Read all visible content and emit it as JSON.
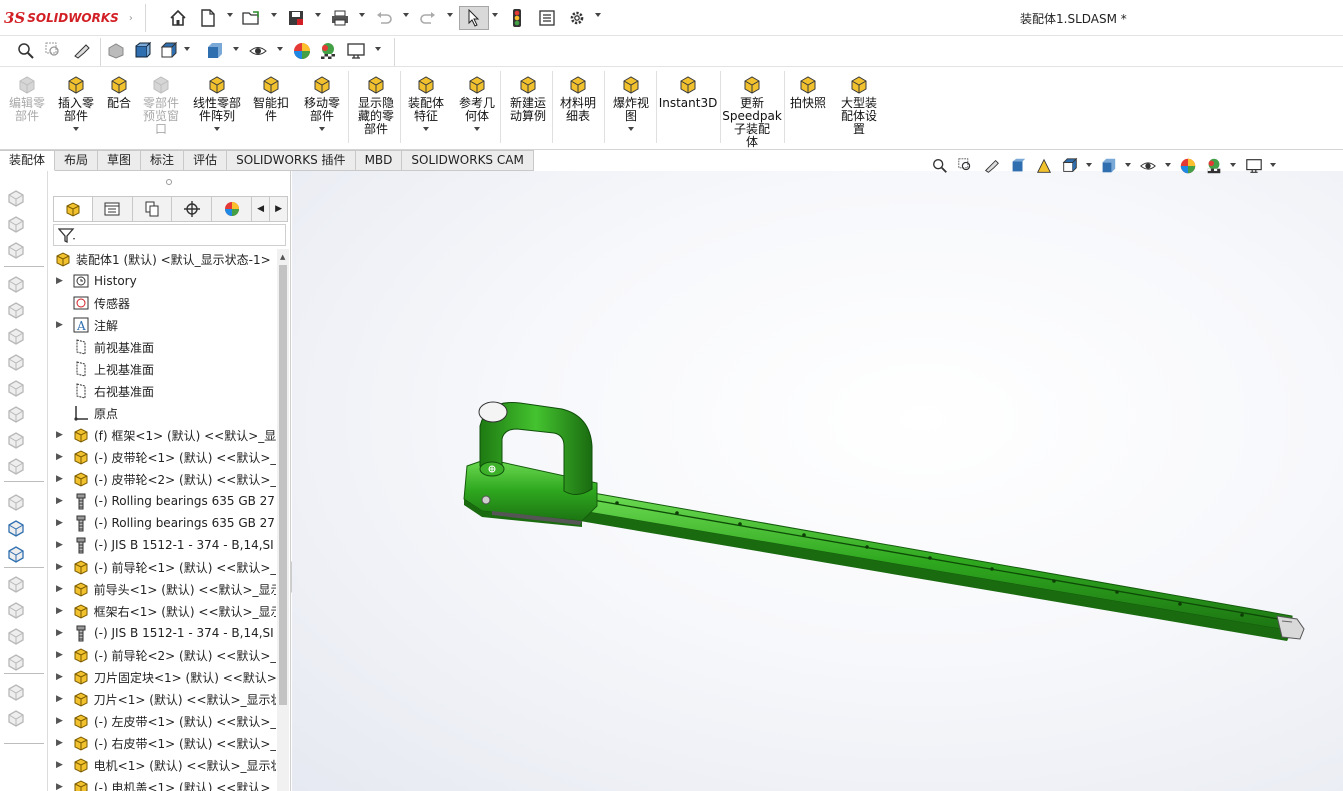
{
  "app": {
    "brand_ds": "3S",
    "brand_name": "SOLIDWORKS",
    "doc_title": "装配体1.SLDASM *"
  },
  "quick_toolbar": {
    "icons": [
      "home-icon",
      "new-document-icon",
      "open-icon",
      "save-icon",
      "print-icon",
      "undo-icon",
      "redo-icon",
      "select-arrow-icon",
      "rebuild-traffic-light-icon",
      "file-properties-icon",
      "options-gear-icon"
    ]
  },
  "ribbon": {
    "items": [
      {
        "label": "编辑零\n部件",
        "disabled": true,
        "dropdown": false
      },
      {
        "label": "插入零\n部件",
        "disabled": false,
        "dropdown": true
      },
      {
        "label": "配合",
        "disabled": false,
        "dropdown": false
      },
      {
        "label": "零部件\n预览窗\n口",
        "disabled": true,
        "dropdown": false
      },
      {
        "label": "线性零部\n件阵列",
        "disabled": false,
        "dropdown": true
      },
      {
        "label": "智能扣\n件",
        "disabled": false,
        "dropdown": false
      },
      {
        "label": "移动零\n部件",
        "disabled": false,
        "dropdown": true
      },
      {
        "label": "显示隐\n藏的零\n部件",
        "disabled": false,
        "dropdown": false
      },
      {
        "label": "装配体\n特征",
        "disabled": false,
        "dropdown": true
      },
      {
        "label": "参考几\n何体",
        "disabled": false,
        "dropdown": true
      },
      {
        "label": "新建运\n动算例",
        "disabled": false,
        "dropdown": false
      },
      {
        "label": "材料明\n细表",
        "disabled": false,
        "dropdown": false
      },
      {
        "label": "爆炸视\n图",
        "disabled": false,
        "dropdown": true
      },
      {
        "label": "Instant3D",
        "disabled": false,
        "dropdown": false
      },
      {
        "label": "更新\nSpeedpak\n子装配\n体",
        "disabled": false,
        "dropdown": false
      },
      {
        "label": "拍快照",
        "disabled": false,
        "dropdown": false
      },
      {
        "label": "大型装\n配体设\n置",
        "disabled": false,
        "dropdown": false
      }
    ]
  },
  "tabs": [
    {
      "label": "装配体",
      "active": true
    },
    {
      "label": "布局",
      "active": false
    },
    {
      "label": "草图",
      "active": false
    },
    {
      "label": "标注",
      "active": false
    },
    {
      "label": "评估",
      "active": false
    },
    {
      "label": "SOLIDWORKS 插件",
      "active": false
    },
    {
      "label": "MBD",
      "active": false
    },
    {
      "label": "SOLIDWORKS CAM",
      "active": false
    }
  ],
  "feature_tree": {
    "root": "装配体1 (默认) <默认_显示状态-1>",
    "items": [
      {
        "label": "History",
        "icon": "history-icon",
        "expandable": true
      },
      {
        "label": "传感器",
        "icon": "sensor-icon",
        "expandable": false
      },
      {
        "label": "注解",
        "icon": "annotation-icon",
        "expandable": true
      },
      {
        "label": "前视基准面",
        "icon": "plane-icon",
        "expandable": false
      },
      {
        "label": "上视基准面",
        "icon": "plane-icon",
        "expandable": false
      },
      {
        "label": "右视基准面",
        "icon": "plane-icon",
        "expandable": false
      },
      {
        "label": "原点",
        "icon": "origin-icon",
        "expandable": false
      },
      {
        "label": "(f) 框架<1> (默认) <<默认>_显",
        "icon": "part-icon",
        "expandable": true
      },
      {
        "label": "(-) 皮带轮<1> (默认) <<默认>_",
        "icon": "part-icon",
        "expandable": true
      },
      {
        "label": "(-) 皮带轮<2> (默认) <<默认>_",
        "icon": "part-icon",
        "expandable": true
      },
      {
        "label": "(-) Rolling bearings 635 GB 27",
        "icon": "toolbox-part-icon",
        "expandable": true
      },
      {
        "label": "(-) Rolling bearings 635 GB 27",
        "icon": "toolbox-part-icon",
        "expandable": true
      },
      {
        "label": "(-) JIS B 1512-1 - 374 - B,14,SI",
        "icon": "toolbox-part-icon",
        "expandable": true
      },
      {
        "label": "(-) 前导轮<1> (默认) <<默认>_",
        "icon": "part-icon",
        "expandable": true
      },
      {
        "label": "前导头<1> (默认) <<默认>_显示",
        "icon": "part-icon",
        "expandable": true
      },
      {
        "label": "框架右<1> (默认) <<默认>_显示",
        "icon": "part-icon",
        "expandable": true
      },
      {
        "label": "(-) JIS B 1512-1 - 374 - B,14,SI",
        "icon": "toolbox-part-icon",
        "expandable": true
      },
      {
        "label": "(-) 前导轮<2> (默认) <<默认>_",
        "icon": "part-icon",
        "expandable": true
      },
      {
        "label": "刀片固定块<1> (默认) <<默认>",
        "icon": "part-icon",
        "expandable": true
      },
      {
        "label": "刀片<1> (默认) <<默认>_显示状",
        "icon": "part-icon",
        "expandable": true
      },
      {
        "label": "(-) 左皮带<1> (默认) <<默认>_",
        "icon": "part-icon",
        "expandable": true
      },
      {
        "label": "(-) 右皮带<1> (默认) <<默认>_",
        "icon": "part-icon",
        "expandable": true
      },
      {
        "label": "电机<1> (默认) <<默认>_显示状",
        "icon": "part-icon",
        "expandable": true
      },
      {
        "label": "(-) 电机盖<1> (默认) <<默认>_",
        "icon": "part-icon",
        "expandable": true
      }
    ]
  },
  "colors": {
    "model_green": "#2fa81f",
    "model_dark": "#1a6b10",
    "model_light": "#5fd04a",
    "accent_red": "#d21f25"
  }
}
